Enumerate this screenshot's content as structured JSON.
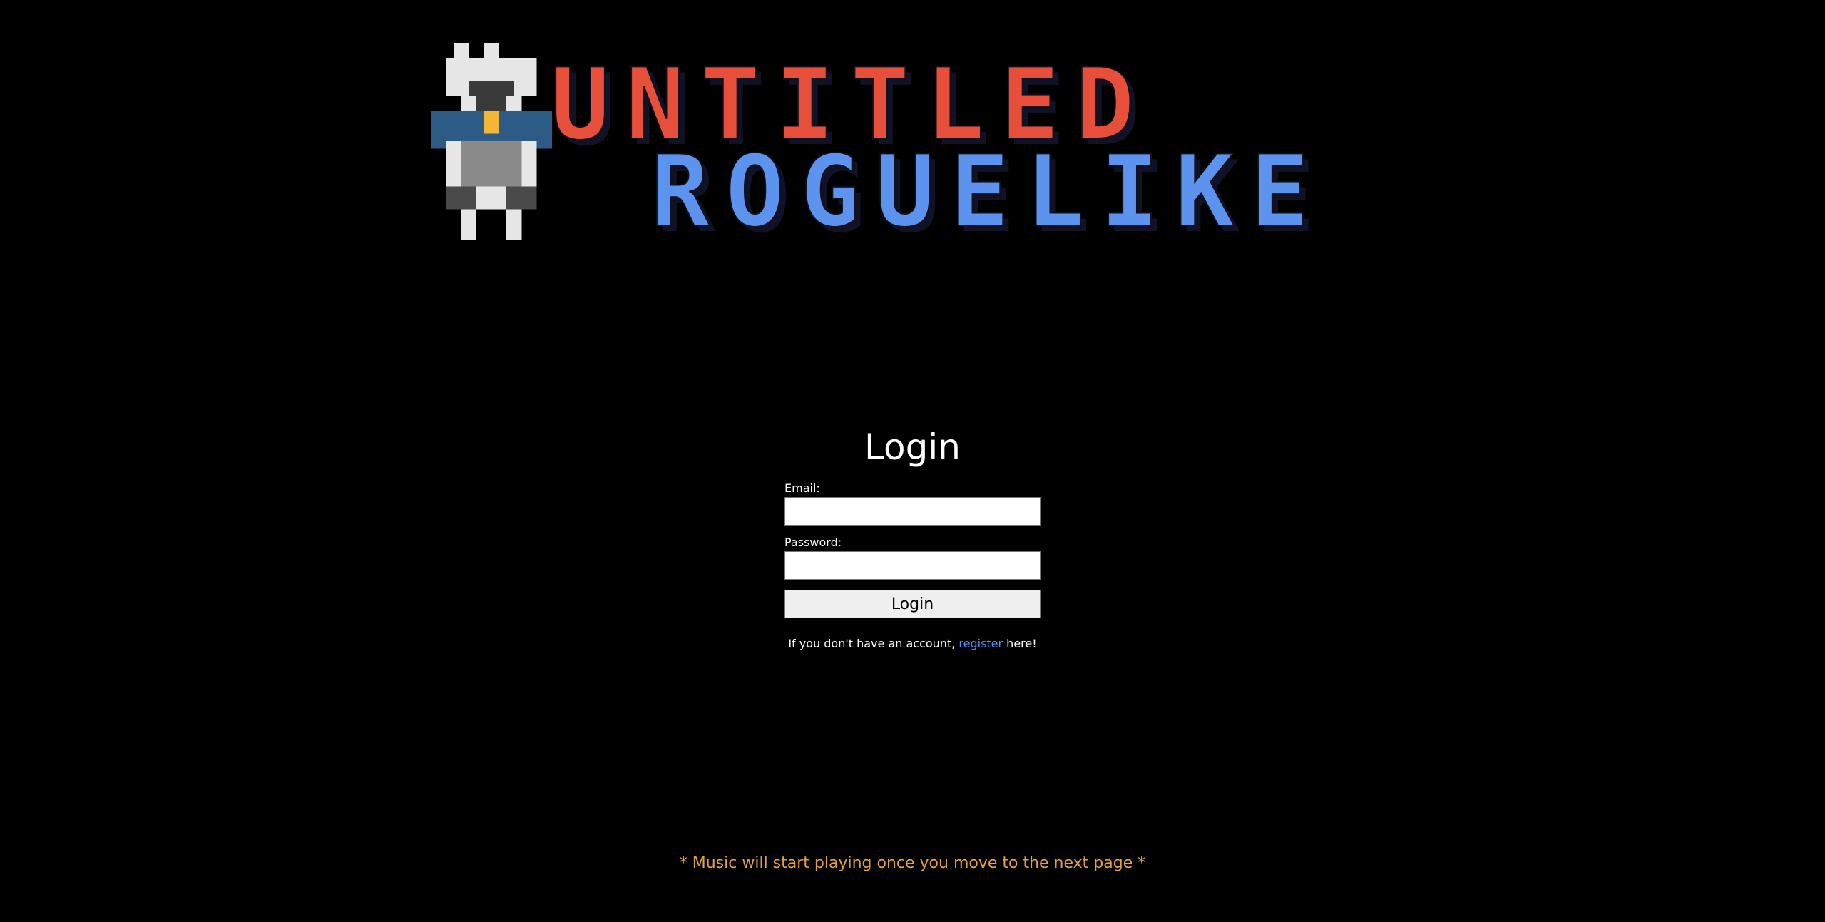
{
  "logo": {
    "line1": "UNTITLED",
    "line2": "ROGUELIKE",
    "line1_color": "#e84f3b",
    "line2_color": "#5b93ee",
    "icon": "pixel-knight-icon"
  },
  "login": {
    "heading": "Login",
    "email_label": "Email:",
    "email_value": "",
    "password_label": "Password:",
    "password_value": "",
    "button_label": "Login",
    "register_prefix": "If you don't have an account, ",
    "register_link": "register",
    "register_suffix": " here!",
    "link_color": "#4f8ff7"
  },
  "footer": {
    "music_note": "* Music will start playing once you move to the next page *",
    "note_color": "#e6a23a"
  }
}
